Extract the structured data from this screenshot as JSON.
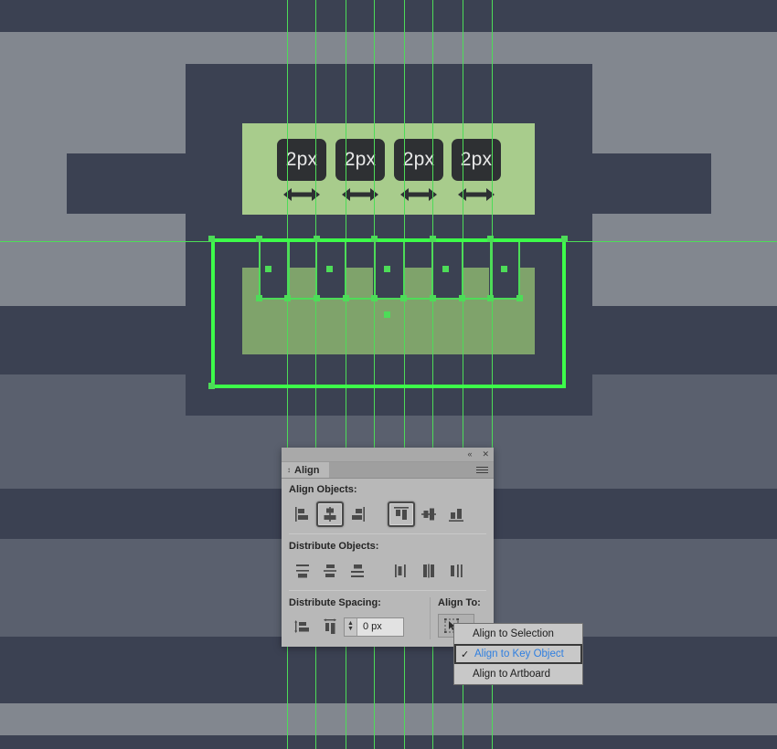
{
  "app": {
    "canvas_background": "#7e838f",
    "artwork_dark": "#3b4152",
    "highlight_green": "#a8cc8c",
    "selection_green": "#4ddc58",
    "badge_bg": "#2e3033"
  },
  "artwork": {
    "badges": [
      {
        "label": "2px"
      },
      {
        "label": "2px"
      },
      {
        "label": "2px"
      },
      {
        "label": "2px"
      }
    ],
    "arrow_icon": "double-arrow-horizontal-icon",
    "guide_count": 8
  },
  "panel": {
    "titlebar": {
      "collapse_label": "«",
      "close_label": "✕"
    },
    "tab": {
      "label": "Align",
      "caret": "↕",
      "menu_icon": "hamburger-menu-icon"
    },
    "sections": [
      {
        "label": "Align Objects:",
        "buttons": [
          {
            "name": "horizontal-align-left",
            "active": false
          },
          {
            "name": "horizontal-align-center",
            "active": true
          },
          {
            "name": "horizontal-align-right",
            "active": false
          },
          {
            "name": "vertical-align-top",
            "active": true
          },
          {
            "name": "vertical-align-center",
            "active": false
          },
          {
            "name": "vertical-align-bottom",
            "active": false
          }
        ]
      },
      {
        "label": "Distribute Objects:",
        "buttons": [
          {
            "name": "vertical-distribute-top",
            "active": false
          },
          {
            "name": "vertical-distribute-center",
            "active": false
          },
          {
            "name": "vertical-distribute-bottom",
            "active": false
          },
          {
            "name": "horizontal-distribute-left",
            "active": false
          },
          {
            "name": "horizontal-distribute-center",
            "active": false
          },
          {
            "name": "horizontal-distribute-right",
            "active": false
          }
        ]
      }
    ],
    "spacing": {
      "label": "Distribute Spacing:",
      "buttons": [
        {
          "name": "vertical-distribute-spacing"
        },
        {
          "name": "horizontal-distribute-spacing"
        }
      ],
      "value": "0 px",
      "stepper_up": "▲",
      "stepper_down": "▼"
    },
    "align_to": {
      "label": "Align To:",
      "icon": "align-to-key-object-icon",
      "chevron": "⌄"
    }
  },
  "dropdown": {
    "items": [
      {
        "label": "Align to Selection",
        "checked": false
      },
      {
        "label": "Align to Key Object",
        "checked": true
      },
      {
        "label": "Align to Artboard",
        "checked": false
      }
    ],
    "check_glyph": "✓"
  }
}
